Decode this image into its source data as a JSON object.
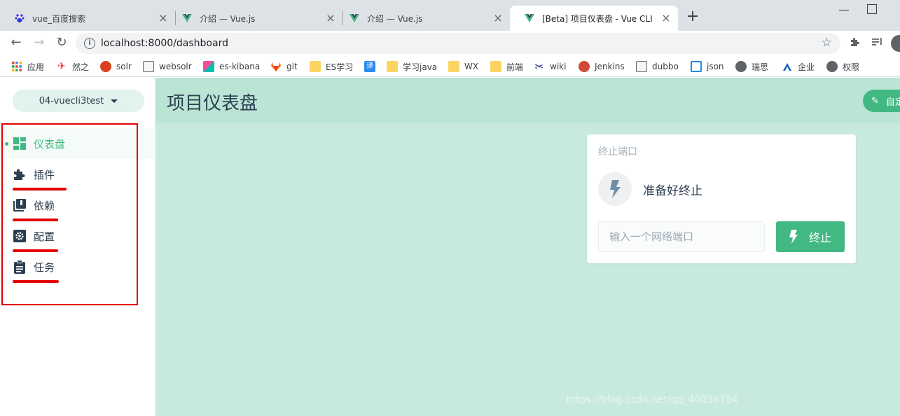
{
  "browser": {
    "tabs": [
      {
        "title": "vue_百度搜索",
        "favicon": "baidu-paw-icon"
      },
      {
        "title": "介绍 — Vue.js",
        "favicon": "vue-logo-icon"
      },
      {
        "title": "介绍 — Vue.js",
        "favicon": "vue-logo-icon"
      },
      {
        "title": "[Beta] 项目仪表盘 - Vue CLI",
        "favicon": "vue-logo-icon",
        "active": true
      }
    ],
    "url": "localhost:8000/dashboard",
    "bookmarks": [
      {
        "label": "应用",
        "icon": "apps-grid-icon"
      },
      {
        "label": "然之",
        "icon": "ranzhi-icon"
      },
      {
        "label": "solr",
        "icon": "solr-icon"
      },
      {
        "label": "websolr",
        "icon": "image-icon"
      },
      {
        "label": "es-kibana",
        "icon": "kibana-icon"
      },
      {
        "label": "git",
        "icon": "gitlab-icon"
      },
      {
        "label": "ES学习",
        "icon": "folder-icon"
      },
      {
        "label": "",
        "icon": "translate-icon"
      },
      {
        "label": "学习java",
        "icon": "folder-icon"
      },
      {
        "label": "WX",
        "icon": "folder-icon"
      },
      {
        "label": "前端",
        "icon": "folder-icon"
      },
      {
        "label": "wiki",
        "icon": "wiki-icon"
      },
      {
        "label": "Jenkins",
        "icon": "jenkins-icon"
      },
      {
        "label": "dubbo",
        "icon": "image-icon"
      },
      {
        "label": "json",
        "icon": "json-icon"
      },
      {
        "label": "瑞思",
        "icon": "globe-icon"
      },
      {
        "label": "企业",
        "icon": "enterprise-icon"
      },
      {
        "label": "权限",
        "icon": "globe-icon"
      }
    ],
    "translate_badge": "译"
  },
  "sidebar": {
    "project_name": "04-vuecli3test",
    "items": [
      {
        "label": "仪表盘",
        "icon": "dashboard-icon",
        "active": true
      },
      {
        "label": "插件",
        "icon": "puzzle-piece-icon"
      },
      {
        "label": "依赖",
        "icon": "library-books-icon"
      },
      {
        "label": "配置",
        "icon": "settings-gear-icon"
      },
      {
        "label": "任务",
        "icon": "clipboard-task-icon"
      }
    ]
  },
  "main": {
    "title": "项目仪表盘",
    "customize_label": "自定义"
  },
  "widget": {
    "title": "终止端口",
    "status": "准备好终止",
    "port_placeholder": "输入一个网络端口",
    "kill_label": "终止"
  },
  "watermark": "https://blog.csdn.net/qq_40036754",
  "colors": {
    "accent": "#42b983",
    "main_bg": "#c7eadd",
    "header_bg": "#bae5d5",
    "annotation_red": "#e50000"
  }
}
